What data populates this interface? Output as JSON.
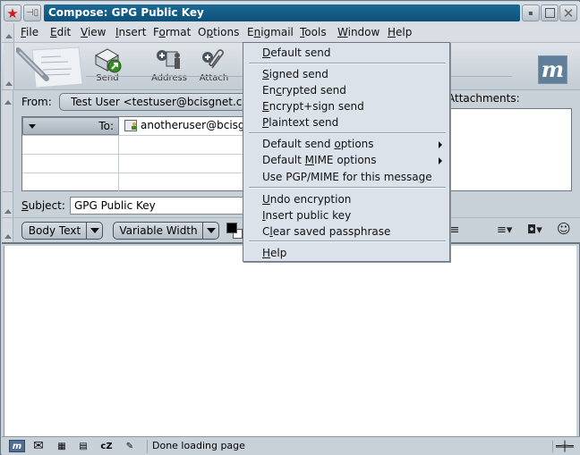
{
  "window": {
    "title": "Compose: GPG Public Key"
  },
  "menubar": {
    "items": [
      {
        "label": "File",
        "mnemonic": "F",
        "rest": "ile"
      },
      {
        "label": "Edit",
        "mnemonic": "E",
        "rest": "dit"
      },
      {
        "label": "View",
        "mnemonic": "V",
        "rest": "iew"
      },
      {
        "label": "Insert",
        "mnemonic": "I",
        "rest": "nsert"
      },
      {
        "label": "Format",
        "pre": "F",
        "mnemonic": "o",
        "rest": "rmat"
      },
      {
        "label": "Options",
        "pre": "O",
        "mnemonic": "p",
        "rest": "tions"
      },
      {
        "label": "Enigmail",
        "pre": "E",
        "mnemonic": "n",
        "rest": "igmail"
      },
      {
        "label": "Tools",
        "mnemonic": "T",
        "rest": "ools"
      },
      {
        "label": "Window",
        "mnemonic": "W",
        "rest": "indow"
      },
      {
        "label": "Help",
        "mnemonic": "H",
        "rest": "elp"
      }
    ]
  },
  "toolbar": {
    "send_label": "Send",
    "address_label": "Address",
    "attach_label": "Attach"
  },
  "header": {
    "from_label": "From:",
    "from_value": "Test User <testuser@bcisgnet.co.uk>",
    "to_label": "To:",
    "to_value": "anotheruser@bcisgnet.co.uk",
    "attachments_label": "Attachments:",
    "subject_label": "Subject:",
    "subject_value": "GPG Public Key"
  },
  "format_toolbar": {
    "paragraph_style": "Body Text",
    "font": "Variable Width",
    "text_color": "#000000",
    "bg_color": "#ffffff"
  },
  "enigmail_menu": {
    "items": [
      {
        "pre": "",
        "mnemonic": "D",
        "rest": "efault send"
      },
      {
        "pre": "",
        "mnemonic": "S",
        "rest": "igned send"
      },
      {
        "pre": "En",
        "mnemonic": "c",
        "rest": "rypted send"
      },
      {
        "pre": "",
        "mnemonic": "E",
        "rest": "ncrypt+sign send"
      },
      {
        "pre": "",
        "mnemonic": "P",
        "rest": "laintext send"
      },
      {
        "pre": "Default send ",
        "mnemonic": "o",
        "rest": "ptions",
        "submenu": true
      },
      {
        "pre": "Default ",
        "mnemonic": "M",
        "rest": "IME options",
        "submenu": true
      },
      {
        "pre": "Use PGP/MIME for this messa",
        "mnemonic": "g",
        "rest": "e"
      },
      {
        "pre": "",
        "mnemonic": "U",
        "rest": "ndo encryption"
      },
      {
        "pre": "",
        "mnemonic": "I",
        "rest": "nsert public key"
      },
      {
        "pre": "C",
        "mnemonic": "l",
        "rest": "ear saved passphrase"
      },
      {
        "pre": "",
        "mnemonic": "H",
        "rest": "elp"
      }
    ]
  },
  "statusbar": {
    "text": "Done loading page"
  }
}
